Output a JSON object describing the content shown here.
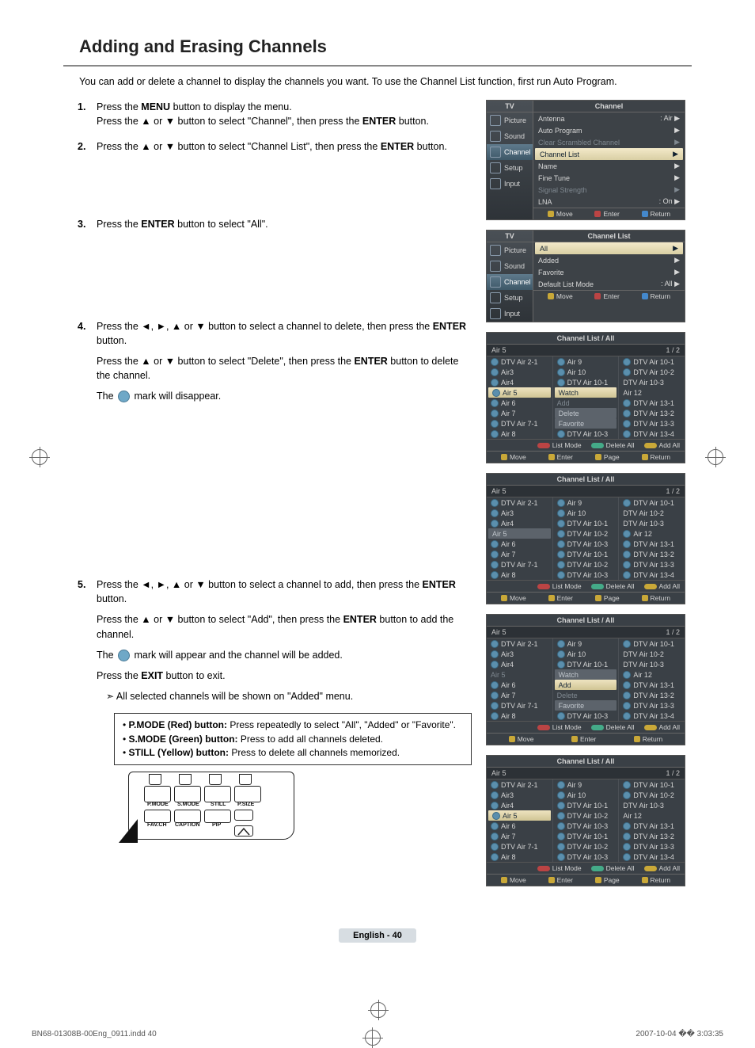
{
  "page": {
    "title": "Adding and Erasing Channels",
    "intro": "You can add or delete a channel to display the channels you want. To use the Channel List function, first run Auto Program.",
    "page_label": "English - 40",
    "foot_file": "BN68-01308B-00Eng_0911.indd   40",
    "foot_time": "2007-10-04   �� 3:03:35"
  },
  "steps": {
    "s1a": "Press the ",
    "s1b": "MENU",
    "s1c": " button to display the menu.",
    "s1d": "Press the ▲ or ▼ button to select \"Channel\", then press the ",
    "s1e": "ENTER",
    "s1f": " button.",
    "s2a": "Press the ▲ or ▼ button to select \"Channel List\", then press the ",
    "s2b": "ENTER",
    "s2c": " button.",
    "s3a": "Press the ",
    "s3b": "ENTER",
    "s3c": " button to select \"All\".",
    "s4a": "Press the  ◄, ►, ▲ or ▼ button to select a channel to delete, then press the ",
    "s4b": "ENTER",
    "s4c": " button.",
    "s4d": "Press the ▲ or ▼ button to select \"Delete\", then press the ",
    "s4e": "ENTER",
    "s4f": " button to delete the channel.",
    "s4g": "The ",
    "s4h": " mark will disappear.",
    "s5a": "Press the ◄, ►, ▲ or ▼ button to select a channel to add, then press the ",
    "s5b": "ENTER",
    "s5c": " button.",
    "s5d": "Press the ▲ or ▼ button to select \"Add\", then press the ",
    "s5e": "ENTER",
    "s5f": " button to add the channel.",
    "s5g": "The ",
    "s5h": " mark will appear and the channel will be added.",
    "s5i": "Press the ",
    "s5j": "EXIT",
    "s5k": " button to exit.",
    "s5l": "All selected channels will be shown on \"Added\" menu."
  },
  "buttons_box": {
    "pmode_label": "P.MODE (Red) button:",
    "pmode_text": " Press repeatedly to select \"All\", \"Added\" or \"Favorite\".",
    "smode_label": "S.MODE (Green) button:",
    "smode_text": " Press to add all channels deleted.",
    "still_label": "STILL (Yellow) button:",
    "still_text": " Press to delete all channels memorized."
  },
  "remote": {
    "pmode": "P.MODE",
    "smode": "S.MODE",
    "still": "STILL",
    "psize": "P.SIZE",
    "favch": "FAV.CH",
    "caption": "CAPTION",
    "pip": "PIP"
  },
  "osd1": {
    "tv": "TV",
    "title": "Channel",
    "side": [
      "Picture",
      "Sound",
      "Channel",
      "Setup",
      "Input"
    ],
    "rows": [
      {
        "l": "Antenna",
        "r": ": Air",
        "dim": false
      },
      {
        "l": "Auto Program",
        "r": "",
        "dim": false
      },
      {
        "l": "Clear Scrambled Channel",
        "r": "",
        "dim": true
      },
      {
        "l": "Channel List",
        "r": "",
        "dim": false,
        "hl": true
      },
      {
        "l": "Name",
        "r": "",
        "dim": false
      },
      {
        "l": "Fine Tune",
        "r": "",
        "dim": false
      },
      {
        "l": "Signal Strength",
        "r": "",
        "dim": true
      },
      {
        "l": "LNA",
        "r": ": On",
        "dim": false
      }
    ],
    "foot": [
      "Move",
      "Enter",
      "Return"
    ]
  },
  "osd2": {
    "tv": "TV",
    "title": "Channel List",
    "side": [
      "Picture",
      "Sound",
      "Channel",
      "Setup",
      "Input"
    ],
    "rows": [
      {
        "l": "All",
        "hl": true
      },
      {
        "l": "Added"
      },
      {
        "l": "Favorite"
      },
      {
        "l": "Default List Mode",
        "r": ": All",
        "chev": true
      }
    ],
    "foot": [
      "Move",
      "Enter",
      "Return"
    ]
  },
  "cl_common": {
    "hdr": "Channel List / All",
    "sub_l": "Air 5",
    "sub_r": "1 / 2",
    "foot1": [
      "List Mode",
      "Delete All",
      "Add All"
    ],
    "foot2": [
      "Move",
      "Enter",
      "Page",
      "Return"
    ],
    "foot2b": [
      "Move",
      "Enter",
      "",
      "Return"
    ]
  },
  "cl1": {
    "col1": [
      {
        "t": "DTV Air 2-1"
      },
      {
        "t": "Air3"
      },
      {
        "t": "Air4"
      },
      {
        "t": "Air 5",
        "hl": true
      },
      {
        "t": "Air 6"
      },
      {
        "t": "Air 7"
      },
      {
        "t": "DTV Air 7-1"
      },
      {
        "t": "Air 8"
      }
    ],
    "col2": [
      {
        "t": "Air 9"
      },
      {
        "t": "Air 10"
      },
      {
        "t": "DTV Air 10-1"
      },
      {
        "t": "Watch",
        "hl": true,
        "nocheck": true
      },
      {
        "t": "Add",
        "dim": true,
        "nocheck": true
      },
      {
        "t": "Delete",
        "hldim": true,
        "nocheck": true
      },
      {
        "t": "Favorite",
        "hldim": true,
        "nocheck": true
      },
      {
        "t": "DTV Air 10-3"
      }
    ],
    "col3": [
      {
        "t": "DTV Air 10-1"
      },
      {
        "t": "DTV Air 10-2"
      },
      {
        "t": "DTV Air 10-3",
        "nocheck": true
      },
      {
        "t": "Air 12",
        "nocheck": true
      },
      {
        "t": "DTV Air 13-1"
      },
      {
        "t": "DTV Air 13-2"
      },
      {
        "t": "DTV Air 13-3"
      },
      {
        "t": "DTV Air 13-4"
      }
    ]
  },
  "cl2": {
    "col1": [
      {
        "t": "DTV Air 2-1"
      },
      {
        "t": "Air3"
      },
      {
        "t": "Air4"
      },
      {
        "t": "Air 5",
        "hldim": true,
        "nocheck": true
      },
      {
        "t": "Air 6"
      },
      {
        "t": "Air 7"
      },
      {
        "t": "DTV Air 7-1"
      },
      {
        "t": "Air 8"
      }
    ],
    "col2": [
      {
        "t": "Air 9"
      },
      {
        "t": "Air 10"
      },
      {
        "t": "DTV Air 10-1"
      },
      {
        "t": "DTV Air 10-2"
      },
      {
        "t": "DTV Air 10-3"
      },
      {
        "t": "DTV Air 10-1"
      },
      {
        "t": "DTV Air 10-2"
      },
      {
        "t": "DTV Air 10-3"
      }
    ],
    "col3": [
      {
        "t": "DTV Air 10-1"
      },
      {
        "t": "DTV Air 10-2",
        "nocheck": true
      },
      {
        "t": "DTV Air 10-3",
        "nocheck": true
      },
      {
        "t": "Air 12"
      },
      {
        "t": "DTV Air 13-1"
      },
      {
        "t": "DTV Air 13-2"
      },
      {
        "t": "DTV Air 13-3"
      },
      {
        "t": "DTV Air 13-4"
      }
    ]
  },
  "cl3": {
    "col1": [
      {
        "t": "DTV Air 2-1"
      },
      {
        "t": "Air3"
      },
      {
        "t": "Air4"
      },
      {
        "t": "Air 5",
        "dim": true,
        "nocheck": true
      },
      {
        "t": "Air 6"
      },
      {
        "t": "Air 7"
      },
      {
        "t": "DTV Air 7-1"
      },
      {
        "t": "Air 8"
      }
    ],
    "col2": [
      {
        "t": "Air 9"
      },
      {
        "t": "Air 10"
      },
      {
        "t": "DTV Air 10-1"
      },
      {
        "t": "Watch",
        "hldim": true,
        "nocheck": true
      },
      {
        "t": "Add",
        "hl": true,
        "nocheck": true
      },
      {
        "t": "Delete",
        "dim": true,
        "nocheck": true
      },
      {
        "t": "Favorite",
        "hldim": true,
        "nocheck": true
      },
      {
        "t": "DTV Air 10-3"
      }
    ],
    "col3": [
      {
        "t": "DTV Air 10-1"
      },
      {
        "t": "DTV Air 10-2",
        "nocheck": true
      },
      {
        "t": "DTV Air 10-3",
        "nocheck": true
      },
      {
        "t": "Air 12"
      },
      {
        "t": "DTV Air 13-1"
      },
      {
        "t": "DTV Air 13-2"
      },
      {
        "t": "DTV Air 13-3"
      },
      {
        "t": "DTV Air 13-4"
      }
    ]
  },
  "cl4": {
    "col1": [
      {
        "t": "DTV Air 2-1"
      },
      {
        "t": "Air3"
      },
      {
        "t": "Air4"
      },
      {
        "t": "Air 5",
        "hl": true
      },
      {
        "t": "Air 6"
      },
      {
        "t": "Air 7"
      },
      {
        "t": "DTV Air 7-1"
      },
      {
        "t": "Air 8"
      }
    ],
    "col2": [
      {
        "t": "Air 9"
      },
      {
        "t": "Air 10"
      },
      {
        "t": "DTV Air 10-1"
      },
      {
        "t": "DTV Air 10-2"
      },
      {
        "t": "DTV Air 10-3"
      },
      {
        "t": "DTV Air 10-1"
      },
      {
        "t": "DTV Air 10-2"
      },
      {
        "t": "DTV Air 10-3"
      }
    ],
    "col3": [
      {
        "t": "DTV Air 10-1"
      },
      {
        "t": "DTV Air 10-2"
      },
      {
        "t": "DTV Air 10-3",
        "nocheck": true
      },
      {
        "t": "Air 12",
        "nocheck": true
      },
      {
        "t": "DTV Air 13-1"
      },
      {
        "t": "DTV Air 13-2"
      },
      {
        "t": "DTV Air 13-3"
      },
      {
        "t": "DTV Air 13-4"
      }
    ]
  }
}
